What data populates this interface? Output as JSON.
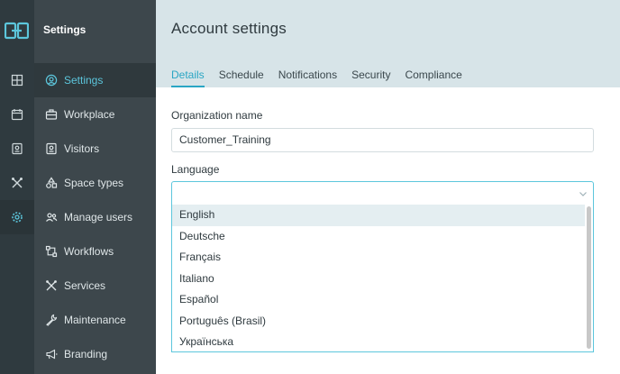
{
  "app": {
    "section_title": "Settings",
    "rail_icons": [
      "building-icon",
      "calendar-icon",
      "visitor-badge-icon",
      "tools-icon",
      "gear-icon"
    ]
  },
  "sidebar": {
    "items": [
      {
        "label": "Settings",
        "icon": "user-circle-icon",
        "active": true
      },
      {
        "label": "Workplace",
        "icon": "briefcase-icon"
      },
      {
        "label": "Visitors",
        "icon": "visitor-badge-icon"
      },
      {
        "label": "Space types",
        "icon": "shapes-icon"
      },
      {
        "label": "Manage users",
        "icon": "users-icon"
      },
      {
        "label": "Workflows",
        "icon": "workflow-icon"
      },
      {
        "label": "Services",
        "icon": "tools-icon"
      },
      {
        "label": "Maintenance",
        "icon": "wrench-icon"
      },
      {
        "label": "Branding",
        "icon": "megaphone-icon"
      }
    ]
  },
  "page": {
    "title": "Account settings",
    "tabs": [
      {
        "label": "Details",
        "active": true
      },
      {
        "label": "Schedule"
      },
      {
        "label": "Notifications"
      },
      {
        "label": "Security"
      },
      {
        "label": "Compliance"
      }
    ]
  },
  "form": {
    "org_label": "Organization name",
    "org_value": "Customer_Training",
    "language_label": "Language",
    "language_value": "",
    "language_options": [
      "English",
      "Deutsche",
      "Français",
      "Italiano",
      "Español",
      "Português (Brasil)",
      "Українська"
    ],
    "highlighted_option": "English"
  },
  "colors": {
    "accent": "#2aa6c4",
    "rail_bg": "#2f3a3f",
    "nav_bg": "#3d474c",
    "header_bg": "#d7e4e8"
  }
}
